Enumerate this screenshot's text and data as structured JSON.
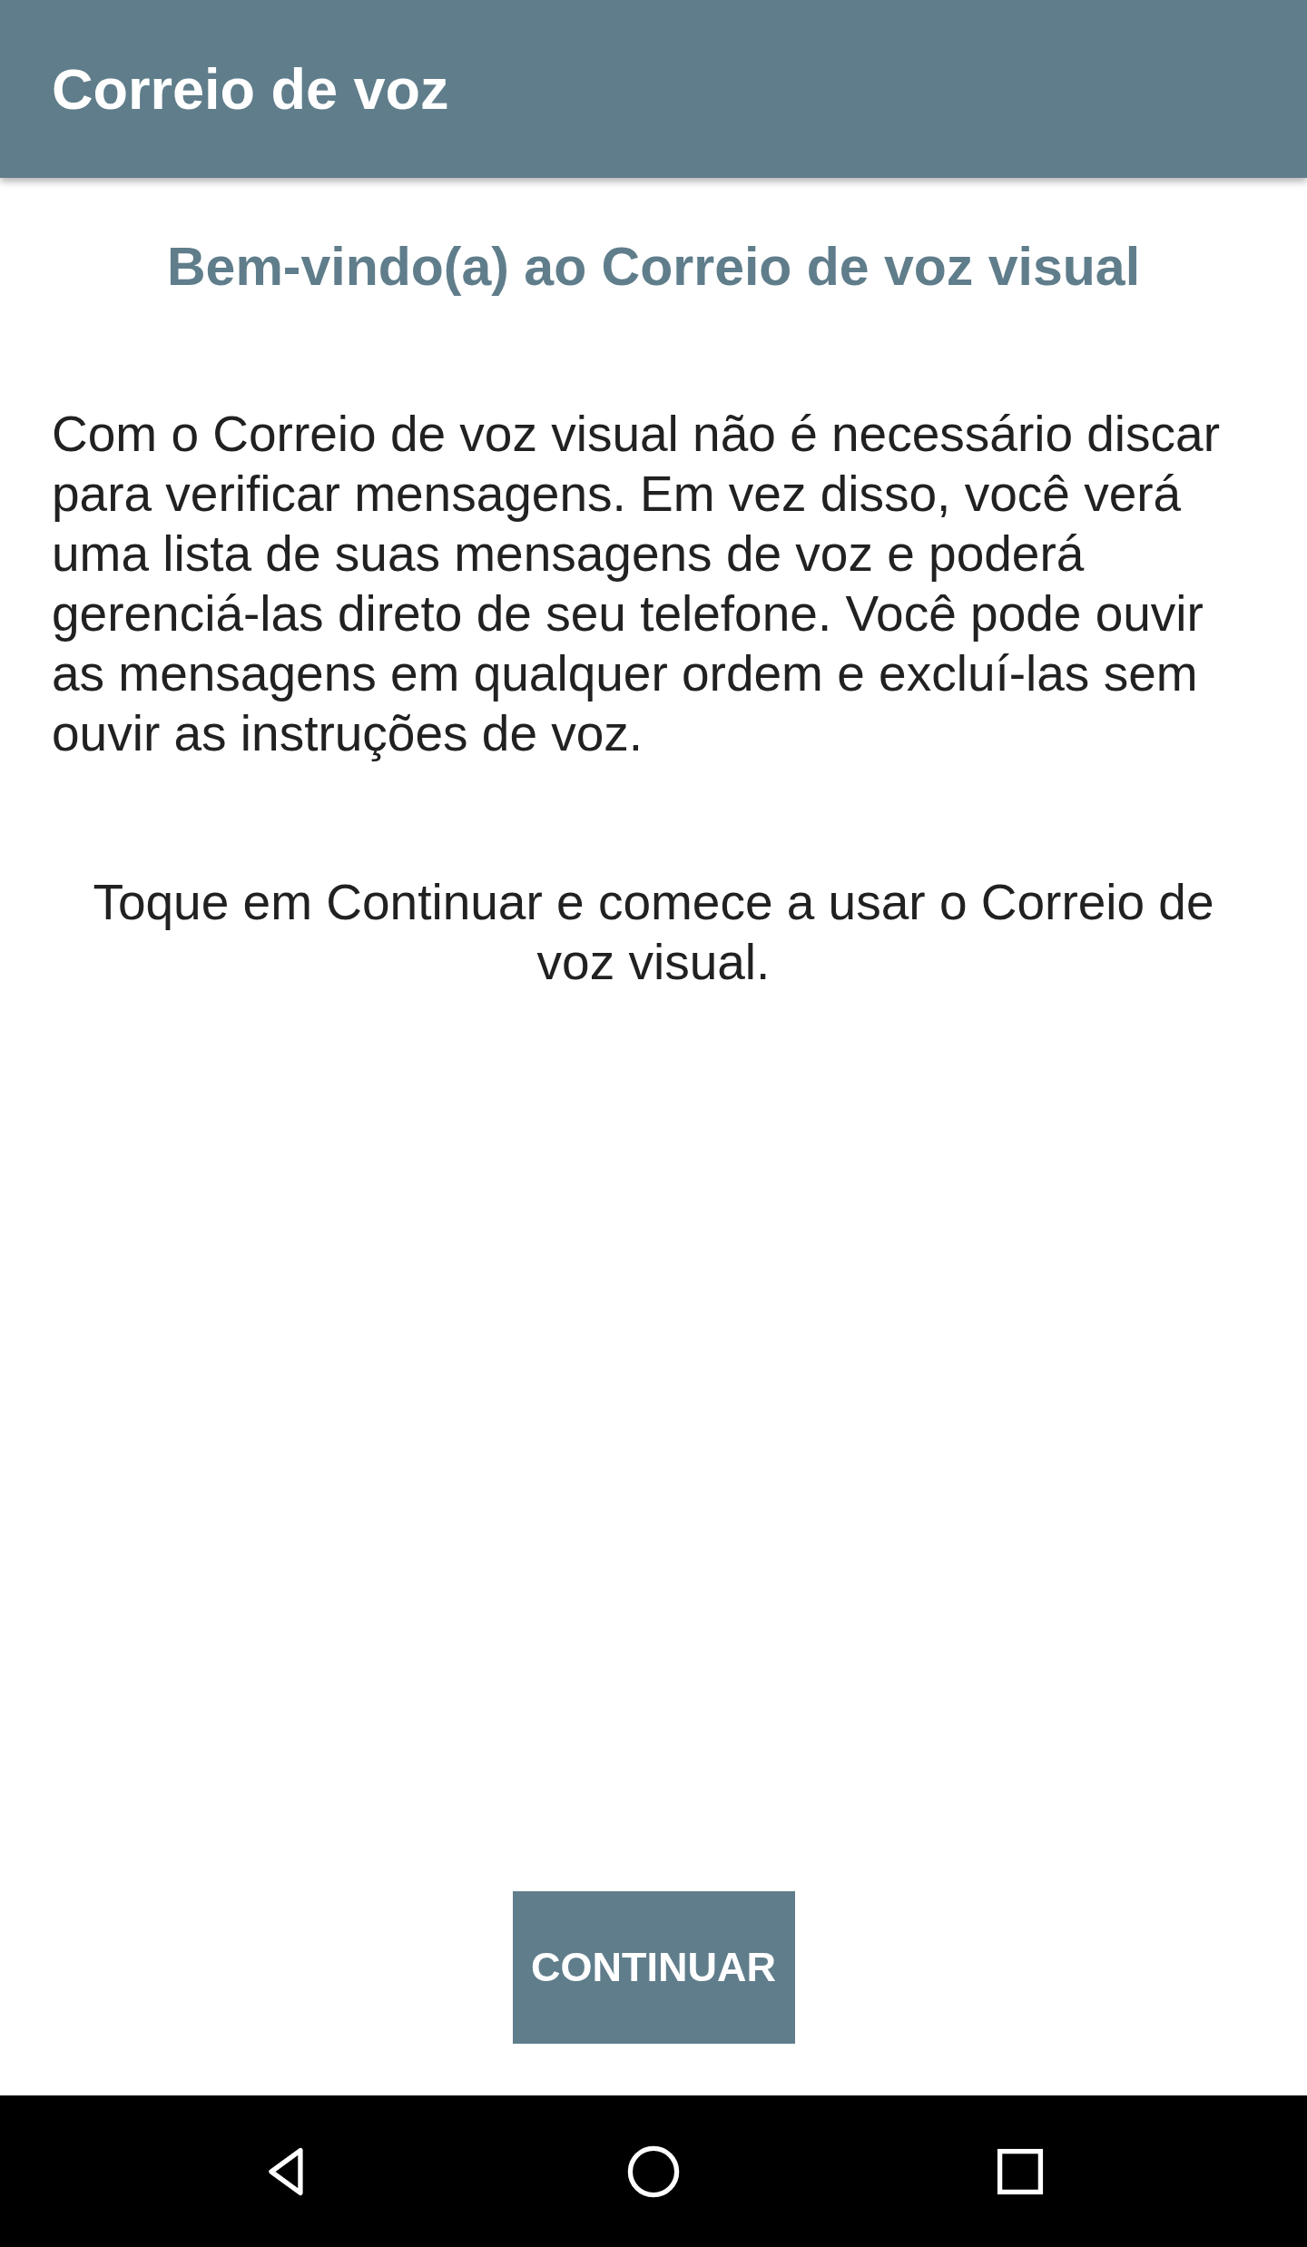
{
  "app_bar": {
    "title": "Correio de voz"
  },
  "heading": "Bem-vindo(a) ao Correio de voz visual",
  "paragraphs": [
    {
      "text": "Com o Correio de voz visual não é necessário discar para verificar mensagens. Em vez disso, você verá uma lista de suas mensagens de voz e poderá gerenciá-las direto de seu telefone. Você pode ouvir as mensagens em qualquer ordem e excluí-las sem ouvir as instruções de voz.",
      "kind": "body"
    },
    {
      "text": "Toque em Continuar e comece a usar o Correio de voz visual.",
      "kind": "prompt"
    }
  ],
  "button": {
    "label": "CONTINUAR"
  }
}
